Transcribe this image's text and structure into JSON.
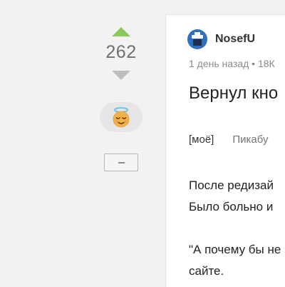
{
  "rating": {
    "score": "262",
    "colors": {
      "up": "#8ac858",
      "down": "#bdbdbd"
    },
    "emoji_icon": "angel-face-icon",
    "collapse_icon": "minus-icon"
  },
  "post": {
    "author": "NosefU",
    "meta": "1 день назад • 18К",
    "title": "Вернул кно",
    "tags": [
      "[моё]",
      "Пикабу"
    ],
    "body": [
      "После редизай",
      "Было больно и",
      "",
      "\"А почему бы не",
      "сайте."
    ]
  }
}
